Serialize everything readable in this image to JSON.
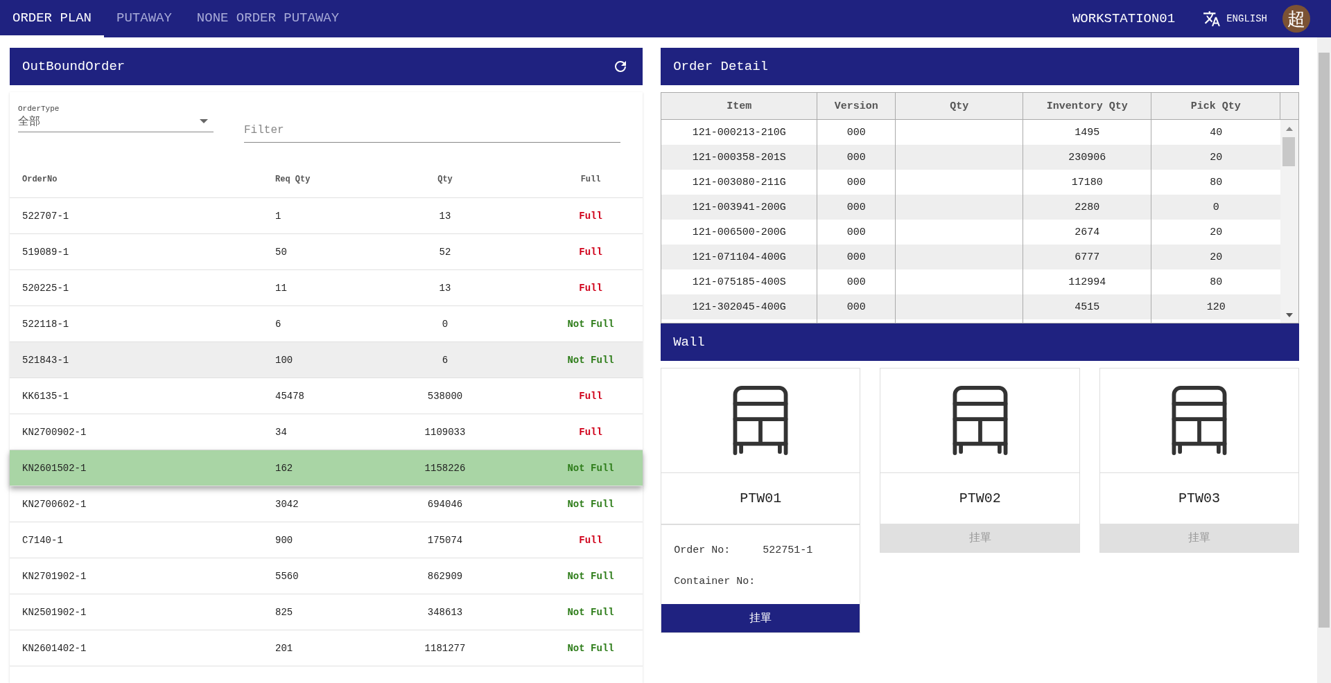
{
  "nav": {
    "tabs": [
      {
        "label": "ORDER PLAN",
        "selected": true
      },
      {
        "label": "PUTAWAY",
        "selected": false
      },
      {
        "label": "NONE ORDER PUTAWAY",
        "selected": false
      }
    ],
    "workstation": "WORKSTATION01",
    "language": "ENGLISH",
    "avatar": "超"
  },
  "outbound": {
    "title": "OutBoundOrder",
    "order_type": {
      "label": "OrderType",
      "value": "全部"
    },
    "filter": {
      "placeholder": "Filter"
    },
    "columns": [
      "OrderNo",
      "Req Qty",
      "Qty",
      "Full"
    ],
    "rows": [
      {
        "order_no": "522707-1",
        "req_qty": "1",
        "qty": "13",
        "status": "Full",
        "full": true,
        "hovered": false,
        "selected": false
      },
      {
        "order_no": "519089-1",
        "req_qty": "50",
        "qty": "52",
        "status": "Full",
        "full": true,
        "hovered": false,
        "selected": false
      },
      {
        "order_no": "520225-1",
        "req_qty": "11",
        "qty": "13",
        "status": "Full",
        "full": true,
        "hovered": false,
        "selected": false
      },
      {
        "order_no": "522118-1",
        "req_qty": "6",
        "qty": "0",
        "status": "Not Full",
        "full": false,
        "hovered": false,
        "selected": false
      },
      {
        "order_no": "521843-1",
        "req_qty": "100",
        "qty": "6",
        "status": "Not Full",
        "full": false,
        "hovered": true,
        "selected": false
      },
      {
        "order_no": "KK6135-1",
        "req_qty": "45478",
        "qty": "538000",
        "status": "Full",
        "full": true,
        "hovered": false,
        "selected": false
      },
      {
        "order_no": "KN2700902-1",
        "req_qty": "34",
        "qty": "1109033",
        "status": "Full",
        "full": true,
        "hovered": false,
        "selected": false
      },
      {
        "order_no": "KN2601502-1",
        "req_qty": "162",
        "qty": "1158226",
        "status": "Not Full",
        "full": false,
        "hovered": false,
        "selected": true
      },
      {
        "order_no": "KN2700602-1",
        "req_qty": "3042",
        "qty": "694046",
        "status": "Not Full",
        "full": false,
        "hovered": false,
        "selected": false
      },
      {
        "order_no": "C7140-1",
        "req_qty": "900",
        "qty": "175074",
        "status": "Full",
        "full": true,
        "hovered": false,
        "selected": false
      },
      {
        "order_no": "KN2701902-1",
        "req_qty": "5560",
        "qty": "862909",
        "status": "Not Full",
        "full": false,
        "hovered": false,
        "selected": false
      },
      {
        "order_no": "KN2501902-1",
        "req_qty": "825",
        "qty": "348613",
        "status": "Not Full",
        "full": false,
        "hovered": false,
        "selected": false
      },
      {
        "order_no": "KN2601402-1",
        "req_qty": "201",
        "qty": "1181277",
        "status": "Not Full",
        "full": false,
        "hovered": false,
        "selected": false
      }
    ]
  },
  "order_detail": {
    "title": "Order Detail",
    "columns": [
      "Item",
      "Version",
      "Qty",
      "Inventory Qty",
      "Pick Qty"
    ],
    "rows": [
      [
        "121-000213-210G",
        "000",
        "",
        "1495",
        "40"
      ],
      [
        "121-000358-201S",
        "000",
        "",
        "230906",
        "20"
      ],
      [
        "121-003080-211G",
        "000",
        "",
        "17180",
        "80"
      ],
      [
        "121-003941-200G",
        "000",
        "",
        "2280",
        "0"
      ],
      [
        "121-006500-200G",
        "000",
        "",
        "2674",
        "20"
      ],
      [
        "121-071104-400G",
        "000",
        "",
        "6777",
        "20"
      ],
      [
        "121-075185-400S",
        "000",
        "",
        "112994",
        "80"
      ],
      [
        "121-302045-400G",
        "000",
        "",
        "4515",
        "120"
      ]
    ]
  },
  "wall": {
    "title": "Wall",
    "cards": [
      {
        "name": "PTW01",
        "selected": true,
        "order_no_label": "Order No:",
        "order_no": "522751-1",
        "container_no_label": "Container No:",
        "button": {
          "label": "挂單",
          "disabled": false
        }
      },
      {
        "name": "PTW02",
        "selected": false,
        "button": {
          "label": "挂單",
          "disabled": true
        }
      },
      {
        "name": "PTW03",
        "selected": false,
        "button": {
          "label": "挂單",
          "disabled": true
        }
      }
    ]
  }
}
